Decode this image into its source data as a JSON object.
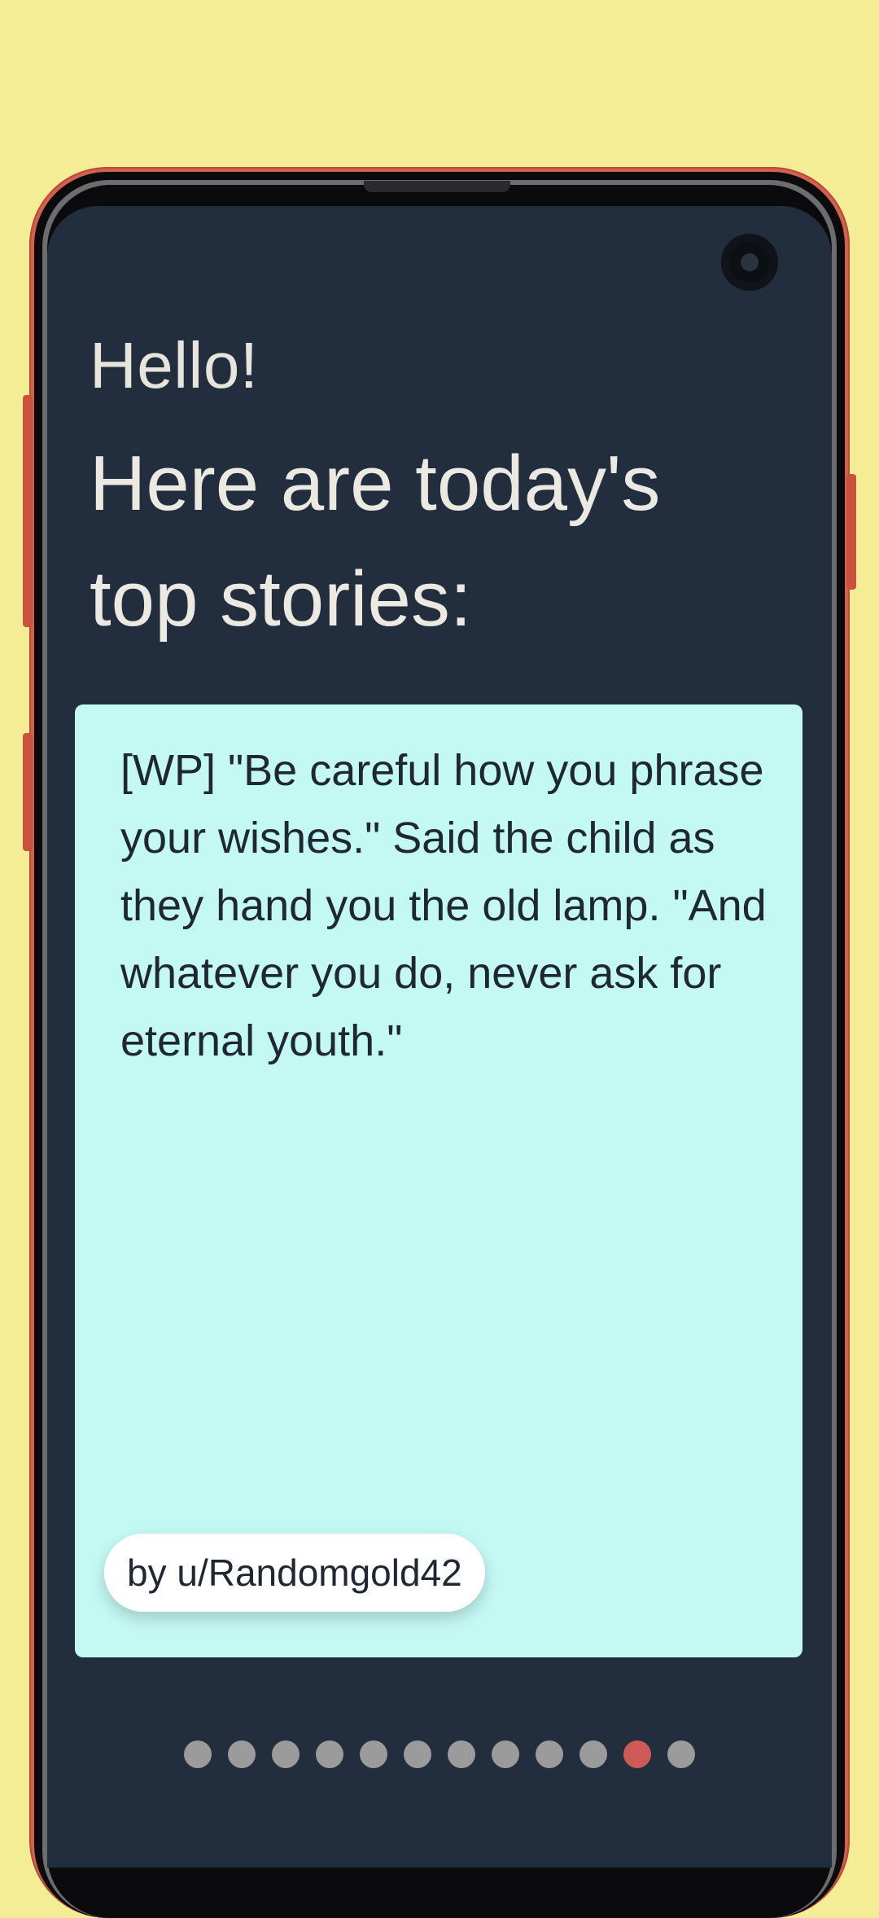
{
  "greeting": "Hello!",
  "headline": "Here are today's top stories:",
  "story": {
    "text": "[WP] \"Be careful how you phrase your wishes.\" Said the child as they hand you the old lamp. \"And whatever you do, never ask for eternal youth.\"",
    "author": "by u/Randomgold42"
  },
  "pagination": {
    "total": 12,
    "active_index": 10
  },
  "colors": {
    "background": "#f5ed95",
    "screen": "#222e3e",
    "card": "#c4f8f3",
    "dot": "#9b9b9b",
    "dot_active": "#cc5a57",
    "phone_frame": "#d4604e"
  }
}
